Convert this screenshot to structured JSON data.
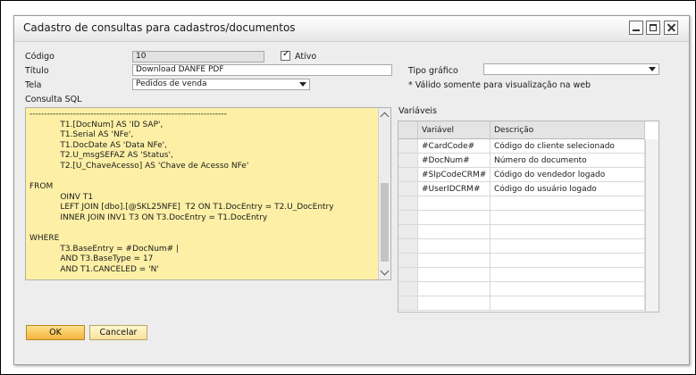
{
  "window": {
    "title": "Cadastro de consultas para cadastros/documentos"
  },
  "form": {
    "codigo_label": "Código",
    "codigo_value": "10",
    "ativo_label": "Ativo",
    "ativo_checked": true,
    "titulo_label": "Título",
    "titulo_value": "Download DANFE PDF",
    "tela_label": "Tela",
    "tela_value": "Pedidos de venda",
    "tipo_grafico_label": "Tipo gráfico",
    "tipo_grafico_value": "",
    "tipo_grafico_note": "* Válido somente para visualização na web",
    "consulta_sql_label": "Consulta SQL",
    "variaveis_label": "Variáveis"
  },
  "sql": {
    "lines": [
      "--------------------------------------------------------------------",
      "            T1.[DocNum] AS 'ID SAP',",
      "            T1.Serial AS 'NFe',",
      "            T1.DocDate AS 'Data NFe',",
      "            T2.U_msgSEFAZ AS 'Status',",
      "            T2.[U_ChaveAcesso] AS 'Chave de Acesso NFe'",
      "",
      "FROM",
      "            OINV T1",
      "            LEFT JOIN [dbo].[@SKL25NFE]  T2 ON T1.DocEntry = T2.U_DocEntry",
      "            INNER JOIN INV1 T3 ON T3.DocEntry = T1.DocEntry",
      "",
      "WHERE",
      "            T3.BaseEntry = #DocNum# |",
      "            AND T3.BaseType = 17",
      "            AND T1.CANCELED = 'N'"
    ]
  },
  "variables_grid": {
    "headers": [
      "Variável",
      "Descrição"
    ],
    "rows": [
      {
        "var": "#CardCode#",
        "desc": "Código do cliente selecionado"
      },
      {
        "var": "#DocNum#",
        "desc": "Número do documento"
      },
      {
        "var": "#SlpCodeCRM#",
        "desc": "Código do vendedor logado"
      },
      {
        "var": "#UserIDCRM#",
        "desc": "Código do usuário logado"
      }
    ]
  },
  "buttons": {
    "ok": "OK",
    "cancel": "Cancelar"
  }
}
